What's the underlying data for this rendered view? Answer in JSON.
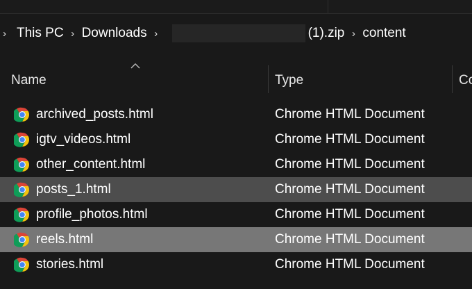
{
  "breadcrumb": {
    "items": [
      "This PC",
      "Downloads",
      "(1).zip",
      "content"
    ]
  },
  "columns": {
    "name": "Name",
    "type": "Type",
    "partial": "Co"
  },
  "files": [
    {
      "name": "archived_posts.html",
      "type": "Chrome HTML Document",
      "state": "normal"
    },
    {
      "name": "igtv_videos.html",
      "type": "Chrome HTML Document",
      "state": "normal"
    },
    {
      "name": "other_content.html",
      "type": "Chrome HTML Document",
      "state": "normal"
    },
    {
      "name": "posts_1.html",
      "type": "Chrome HTML Document",
      "state": "hover"
    },
    {
      "name": "profile_photos.html",
      "type": "Chrome HTML Document",
      "state": "normal"
    },
    {
      "name": "reels.html",
      "type": "Chrome HTML Document",
      "state": "selected"
    },
    {
      "name": "stories.html",
      "type": "Chrome HTML Document",
      "state": "normal"
    }
  ],
  "icons": {
    "file": "chrome-icon",
    "separator": "chevron-right-icon",
    "sort": "sort-up-icon"
  },
  "colors": {
    "background": "#191919",
    "hover_row": "#4d4d4d",
    "selected_row": "#777777",
    "chrome_red": "#db4437",
    "chrome_yellow": "#f4c20d",
    "chrome_green": "#0f9d58",
    "chrome_blue": "#4285f4"
  }
}
